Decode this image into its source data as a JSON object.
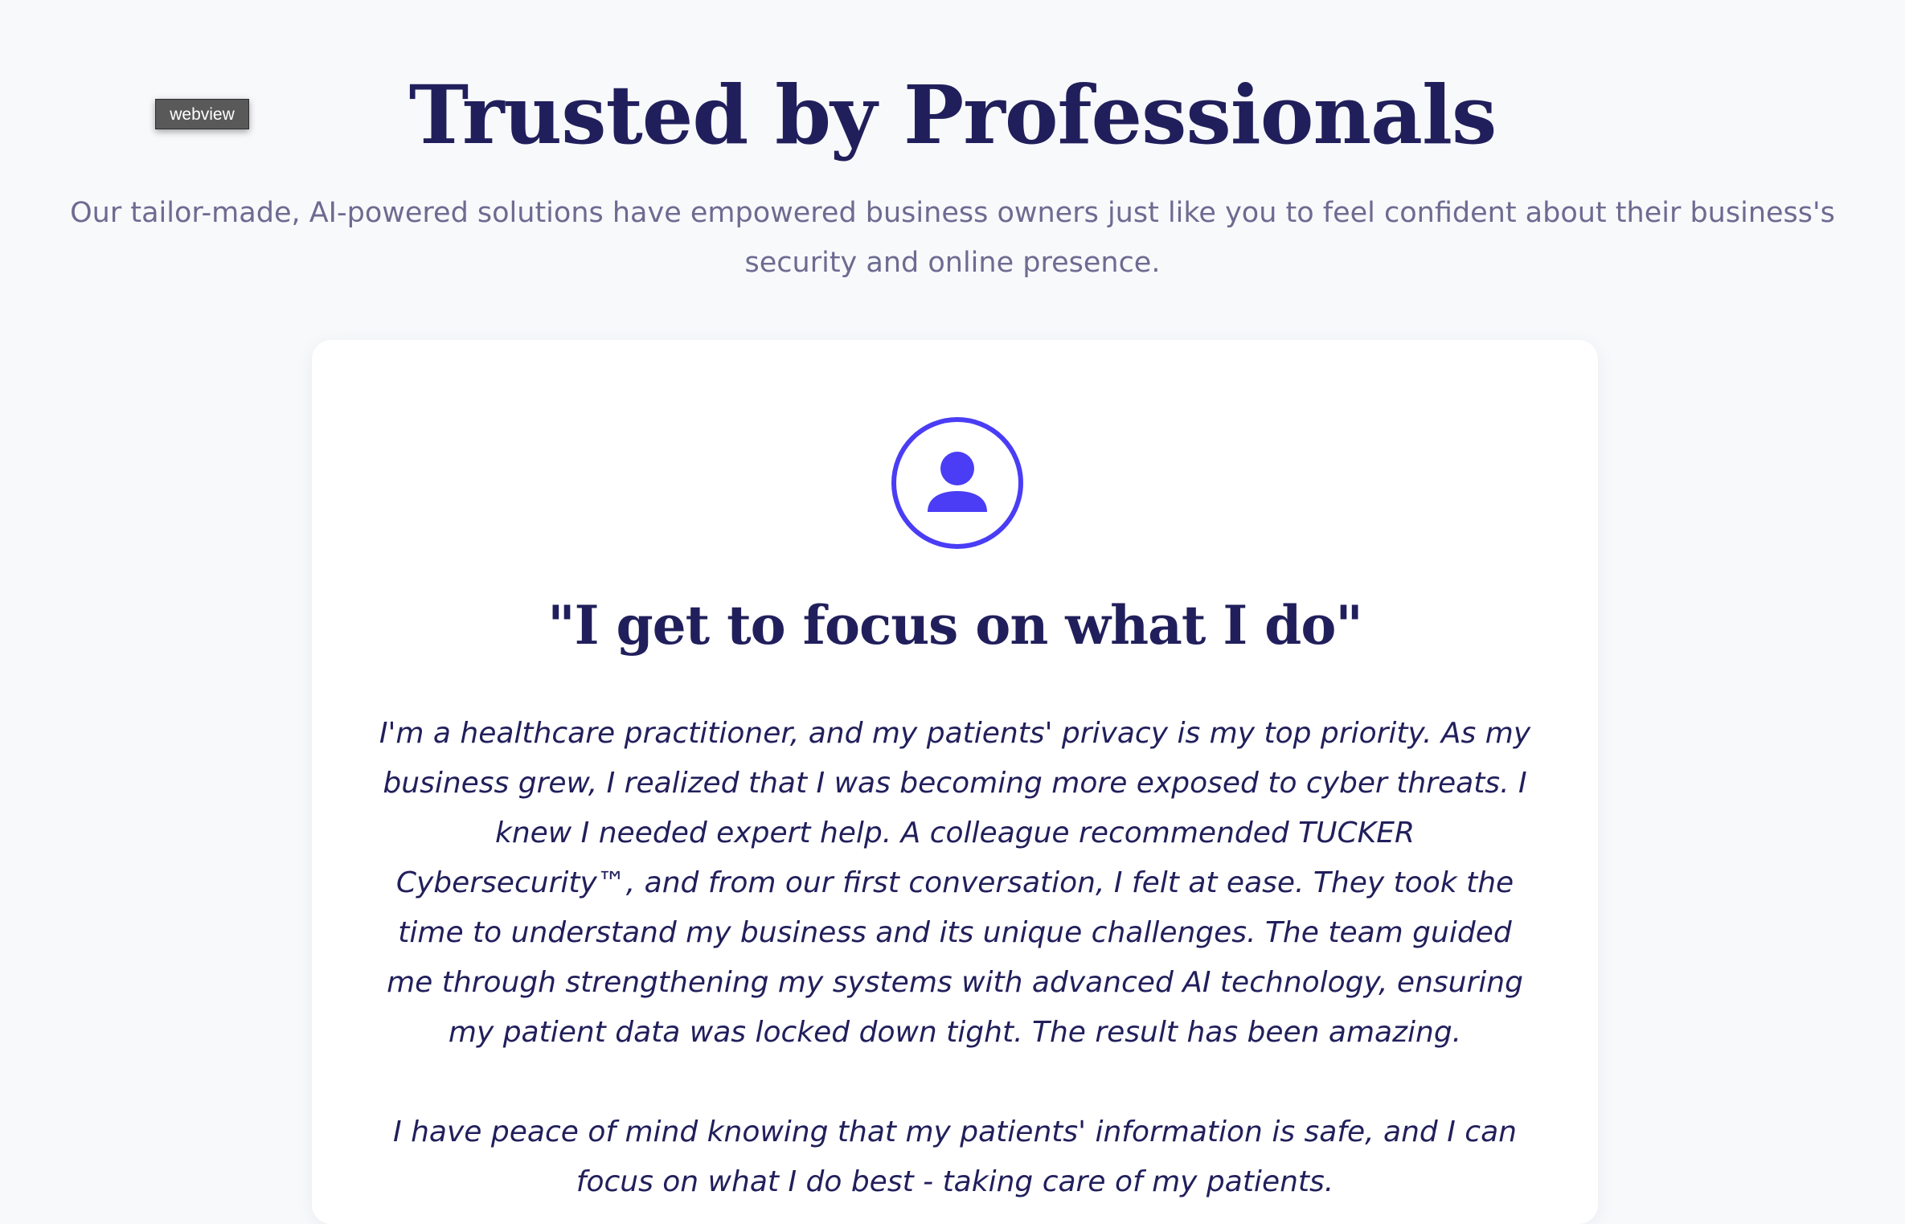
{
  "tooltip": {
    "label": "webview"
  },
  "header": {
    "title": "Trusted by Professionals",
    "subtitle": "Our tailor-made, AI-powered solutions have empowered business owners just like you to feel confident about their business's security and online presence."
  },
  "testimonial": {
    "avatar_icon": "user-icon",
    "quote_title": "\"I get to focus on what I do\"",
    "paragraph_1": "I'm a healthcare practitioner, and my patients' privacy is my top priority. As my business grew, I realized that I was becoming more exposed to cyber threats. I knew I needed expert help. A colleague recommended TUCKER Cybersecurity™, and from our first conversation, I felt at ease. They took the time to understand my business and its unique challenges. The team guided me through strengthening my systems with advanced AI technology, ensuring my patient data was locked down tight. The result has been amazing.",
    "paragraph_2": "I have peace of mind knowing that my patients' information is safe, and I can focus on what I do best - taking care of my patients."
  },
  "colors": {
    "background": "#f8f9fb",
    "heading": "#211f5b",
    "subtitle": "#6c6b91",
    "accent": "#4a3df5",
    "card": "#ffffff"
  }
}
